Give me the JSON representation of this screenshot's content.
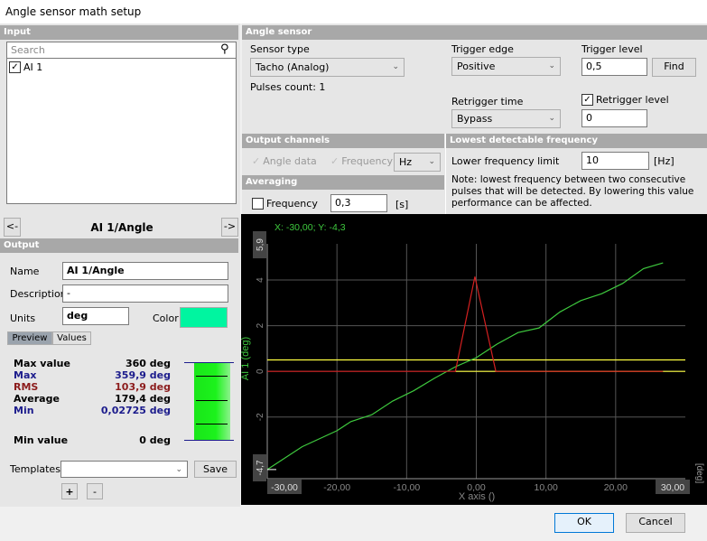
{
  "window": {
    "title": "Angle sensor math setup"
  },
  "input": {
    "header": "Input",
    "search_placeholder": "Search",
    "channels": [
      {
        "label": "AI 1",
        "checked": true
      }
    ]
  },
  "nav": {
    "prev": "<-",
    "next": "->",
    "current": "AI 1/Angle"
  },
  "output": {
    "header": "Output",
    "name_label": "Name",
    "name": "AI 1/Angle",
    "description_label": "Description",
    "description": "-",
    "units_label": "Units",
    "units": "deg",
    "color_label": "Color",
    "color": "#00f5a0",
    "tabs": [
      {
        "label": "Preview",
        "active": true
      },
      {
        "label": "Values",
        "active": false
      }
    ],
    "stats": {
      "max_value_label": "Max value",
      "max_value": "360 deg",
      "max_label": "Max",
      "max": "359,9 deg",
      "rms_label": "RMS",
      "rms": "103,9 deg",
      "avg_label": "Average",
      "avg": "179,4 deg",
      "min_label": "Min",
      "min": "0,02725 deg",
      "min_value_label": "Min value",
      "min_value": "0 deg"
    },
    "templates_label": "Templates",
    "templates_value": "",
    "save": "Save",
    "add": "+",
    "remove": "-"
  },
  "angle_sensor": {
    "header": "Angle sensor",
    "sensor_type_label": "Sensor type",
    "sensor_type": "Tacho (Analog)",
    "pulses_count": "Pulses count: 1",
    "trigger_edge_label": "Trigger edge",
    "trigger_edge": "Positive",
    "trigger_level_label": "Trigger level",
    "trigger_level": "0,5",
    "find": "Find",
    "retrigger_time_label": "Retrigger time",
    "retrigger_time": "Bypass",
    "retrigger_level_label": "Retrigger level",
    "retrigger_level_checked": true,
    "retrigger_level": "0"
  },
  "output_channels": {
    "header": "Output channels",
    "angle_data": "Angle data",
    "frequency": "Frequency",
    "unit": "Hz"
  },
  "averaging": {
    "header": "Averaging",
    "frequency": "Frequency",
    "value": "0,3",
    "unit": "[s]"
  },
  "lowest_freq": {
    "header": "Lowest detectable frequency",
    "label": "Lower frequency limit",
    "value": "10",
    "unit": "[Hz]",
    "note": "Note: lowest frequency between two consecutive pulses that will be detected. By lowering this value performance can be affected."
  },
  "buttons": {
    "ok": "OK",
    "cancel": "Cancel"
  },
  "chart_data": {
    "type": "line",
    "cursor": "X: -30,00; Y: -4,3",
    "xlabel": "X axis ()",
    "ylabel": "AI 1 (deg)",
    "yunit": "[deg]",
    "xlim": [
      -30,
      30
    ],
    "ylim": [
      -4.7,
      5.9
    ],
    "xticks": [
      "-30,00",
      "-20,00",
      "-10,00",
      "0,00",
      "10,00",
      "20,00",
      "30,00"
    ],
    "xtick_values": [
      -30,
      -20,
      -10,
      0,
      10,
      20,
      30
    ],
    "yticks": [
      "5,9",
      "4",
      "2",
      "0",
      "-2",
      "-4,7"
    ],
    "ytick_values": [
      5.9,
      4,
      2,
      0,
      -2,
      -4.7
    ],
    "grid": true,
    "colors": {
      "signal": "#3ec93e",
      "pulse": "#d42020",
      "trigger": "#ffff40"
    },
    "series": [
      {
        "x": [
          -30,
          -25,
          -20,
          -18,
          -15,
          -12,
          -9,
          -6,
          -3,
          0,
          3,
          6,
          9,
          12,
          15,
          18,
          21,
          24,
          26.8
        ],
        "y": [
          -4.3,
          -3.3,
          -2.6,
          -2.2,
          -1.9,
          -1.3,
          -0.85,
          -0.3,
          0.2,
          0.6,
          1.2,
          1.7,
          1.9,
          2.6,
          3.1,
          3.4,
          3.85,
          4.5,
          4.75
        ]
      },
      {
        "x": [
          -30,
          -3,
          -0.2,
          2.8,
          26.8
        ],
        "y": [
          0,
          0,
          4.15,
          0,
          0
        ]
      },
      {
        "x": [
          -30,
          30
        ],
        "y": [
          0.5,
          0.5
        ]
      },
      {
        "x": [
          -3,
          30
        ],
        "y": [
          0,
          0
        ]
      }
    ]
  }
}
